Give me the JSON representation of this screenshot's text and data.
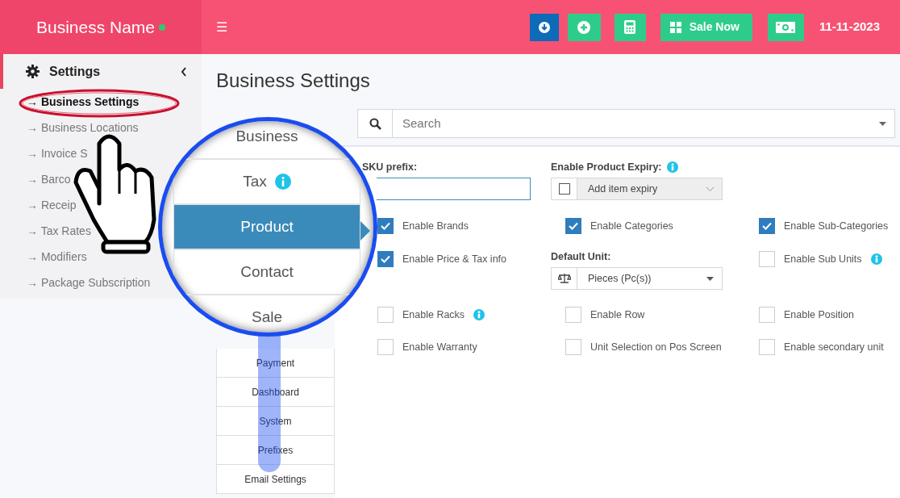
{
  "header": {
    "brand": "Business Name",
    "online": true,
    "menu_glyph": "☰",
    "buttons": [
      {
        "kind": "download"
      },
      {
        "kind": "add"
      },
      {
        "kind": "calculator"
      },
      {
        "kind": "pos",
        "label": "Sale Now"
      },
      {
        "kind": "cash"
      }
    ],
    "date": "11-11-2023"
  },
  "sidebar": {
    "title": "Settings",
    "expanded": true,
    "items": [
      {
        "label": "→ Business Settings",
        "selected": true
      },
      {
        "label": "→ Business Locations",
        "selected": false
      },
      {
        "label": "→ Invoice S",
        "selected": false
      },
      {
        "label": "→ Barco",
        "selected": false
      },
      {
        "label": "→ Receip",
        "selected": false
      },
      {
        "label": "→ Tax Rates",
        "selected": false
      },
      {
        "label": "→ Modifiers",
        "selected": false
      },
      {
        "label": "→ Package Subscription",
        "selected": false
      }
    ]
  },
  "page_title": "Business Settings",
  "search": {
    "placeholder": "Search"
  },
  "magnifier": {
    "tabs": [
      {
        "label": "Business",
        "selected": false
      },
      {
        "label": "Tax",
        "selected": false,
        "info": true
      },
      {
        "label": "Product",
        "selected": true
      },
      {
        "label": "Contact",
        "selected": false
      },
      {
        "label": "Sale",
        "selected": false
      }
    ]
  },
  "tabs": [
    {
      "label": "Payment",
      "selected": false
    },
    {
      "label": "Dashboard",
      "selected": false
    },
    {
      "label": "System",
      "selected": false
    },
    {
      "label": "Prefixes",
      "selected": false
    },
    {
      "label": "Email Settings",
      "selected": false
    }
  ],
  "form": {
    "rows": [
      [
        {
          "kind": "text",
          "label": "SKU prefix:"
        },
        {
          "kind": "expiry",
          "label": "Enable Product Expiry:",
          "info": true,
          "checked": false,
          "value": "Add item expiry"
        },
        null
      ],
      [
        {
          "kind": "checkbox",
          "label": "Enable Brands",
          "checked": true
        },
        {
          "kind": "checkbox",
          "label": "Enable Categories",
          "checked": true
        },
        {
          "kind": "checkbox",
          "label": "Enable Sub-Categories",
          "checked": true
        }
      ],
      [
        {
          "kind": "checkbox",
          "label": "Enable Price & Tax info",
          "checked": true
        },
        {
          "kind": "select",
          "label": "Default Unit:",
          "value": "Pieces (Pc(s))"
        },
        {
          "kind": "checkbox",
          "label": "Enable Sub Units",
          "checked": false,
          "info": true
        }
      ],
      [
        {
          "kind": "checkbox",
          "label": "Enable Racks",
          "checked": false,
          "info": true
        },
        {
          "kind": "checkbox",
          "label": "Enable Row",
          "checked": false
        },
        {
          "kind": "checkbox",
          "label": "Enable Position",
          "checked": false
        }
      ],
      [
        {
          "kind": "checkbox",
          "label": "Enable Warranty",
          "checked": false
        },
        {
          "kind": "checkbox",
          "label": "Unit Selection on Pos Screen",
          "checked": false
        },
        {
          "kind": "checkbox",
          "label": "Enable secondary unit",
          "checked": false
        }
      ]
    ]
  }
}
